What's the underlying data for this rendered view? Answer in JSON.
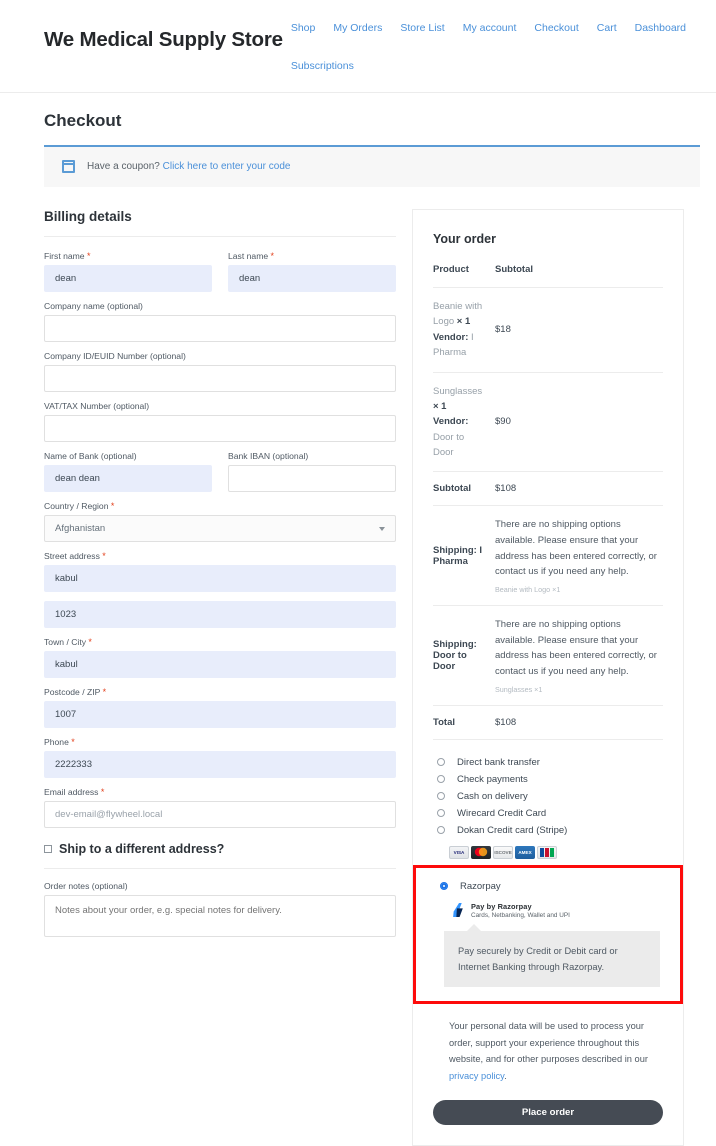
{
  "header": {
    "site_title": "We Medical Supply Store",
    "nav": [
      {
        "label": "Shop"
      },
      {
        "label": "My Orders"
      },
      {
        "label": "Store List"
      },
      {
        "label": "My account"
      },
      {
        "label": "Checkout"
      },
      {
        "label": "Cart"
      },
      {
        "label": "Dashboard"
      },
      {
        "label": "Subscriptions"
      }
    ]
  },
  "page": {
    "title": "Checkout"
  },
  "coupon": {
    "icon": "coupon-ticket-icon",
    "text": "Have a coupon?",
    "link": "Click here to enter your code"
  },
  "billing": {
    "heading": "Billing details",
    "fields": {
      "first_name": {
        "label": "First name",
        "required": true,
        "value": "dean",
        "placeholder": ""
      },
      "last_name": {
        "label": "Last name",
        "required": true,
        "value": "dean",
        "placeholder": ""
      },
      "company_name": {
        "label": "Company name (optional)",
        "required": false,
        "value": "",
        "placeholder": ""
      },
      "company_id": {
        "label": "Company ID/EUID Number (optional)",
        "required": false,
        "value": "",
        "placeholder": ""
      },
      "vat_tax": {
        "label": "VAT/TAX Number (optional)",
        "required": false,
        "value": "",
        "placeholder": ""
      },
      "bank_name": {
        "label": "Name of Bank (optional)",
        "required": false,
        "value": "dean dean",
        "placeholder": ""
      },
      "bank_iban": {
        "label": "Bank IBAN (optional)",
        "required": false,
        "value": "",
        "placeholder": ""
      },
      "country": {
        "label": "Country / Region",
        "required": true,
        "value": "Afghanistan"
      },
      "street_address": {
        "label": "Street address",
        "required": true,
        "value": "kabul",
        "placeholder": ""
      },
      "street_address_2": {
        "label": "",
        "required": false,
        "value": "1023",
        "placeholder": ""
      },
      "city": {
        "label": "Town / City",
        "required": true,
        "value": "kabul",
        "placeholder": ""
      },
      "postcode": {
        "label": "Postcode / ZIP",
        "required": true,
        "value": "1007",
        "placeholder": ""
      },
      "phone": {
        "label": "Phone",
        "required": true,
        "value": "2222333",
        "placeholder": ""
      },
      "email": {
        "label": "Email address",
        "required": true,
        "value": "",
        "placeholder": "dev-email@flywheel.local"
      }
    },
    "ship_different": {
      "label": "Ship to a different address?",
      "checked": false
    },
    "order_notes": {
      "label": "Order notes (optional)",
      "value": "",
      "placeholder": "Notes about your order, e.g. special notes for delivery."
    }
  },
  "order": {
    "title": "Your order",
    "columns": {
      "product": "Product",
      "subtotal": "Subtotal"
    },
    "items": [
      {
        "name": "Beanie with Logo",
        "qty": "× 1",
        "vendor_label": "Vendor:",
        "vendor": "I Pharma",
        "amount": "$18"
      },
      {
        "name": "Sunglasses",
        "qty": "× 1",
        "vendor_label": "Vendor:",
        "vendor": "Door to Door",
        "amount": "$90"
      }
    ],
    "subtotal": {
      "label": "Subtotal",
      "amount": "$108"
    },
    "shipping": [
      {
        "label": "Shipping: I Pharma",
        "message": "There are no shipping options available. Please ensure that your address has been entered correctly, or contact us if you need any help.",
        "sub": "Beanie with Logo ×1"
      },
      {
        "label": "Shipping: Door to Door",
        "message": "There are no shipping options available. Please ensure that your address has been entered correctly, or contact us if you need any help.",
        "sub": "Sunglasses ×1"
      }
    ],
    "total": {
      "label": "Total",
      "amount": "$108"
    }
  },
  "payment": {
    "methods": [
      {
        "label": "Direct bank transfer",
        "selected": false
      },
      {
        "label": "Check payments",
        "selected": false
      },
      {
        "label": "Cash on delivery",
        "selected": false
      },
      {
        "label": "Wirecard Credit Card",
        "selected": false
      },
      {
        "label": "Dokan Credit card (Stripe)",
        "selected": false
      }
    ],
    "card_icons": [
      {
        "name": "visa-icon",
        "text": "VISA"
      },
      {
        "name": "mastercard-icon",
        "text": ""
      },
      {
        "name": "discover-icon",
        "text": "DISCOVER"
      },
      {
        "name": "amex-icon",
        "text": "AMEX"
      },
      {
        "name": "jcb-icon",
        "text": ""
      }
    ],
    "razorpay": {
      "label": "Razorpay",
      "selected": true,
      "logo_title": "Pay by Razorpay",
      "logo_sub": "Cards, Netbanking, Wallet and UPI",
      "description": "Pay securely by Credit or Debit card or Internet Banking through Razorpay."
    },
    "highlight_color": "#fd0b0b"
  },
  "footer": {
    "privacy_text": "Your personal data will be used to process your order, support your experience throughout this website, and for other purposes described in our ",
    "privacy_link": "privacy policy",
    "privacy_tail": ".",
    "place_order": "Place order"
  },
  "colors": {
    "link": "#4a90d9",
    "accent": "#5b9bd5",
    "required": "#e2401c",
    "autofill": "#e8edfb",
    "button": "#454b54",
    "highlight": "#fd0b0b"
  }
}
